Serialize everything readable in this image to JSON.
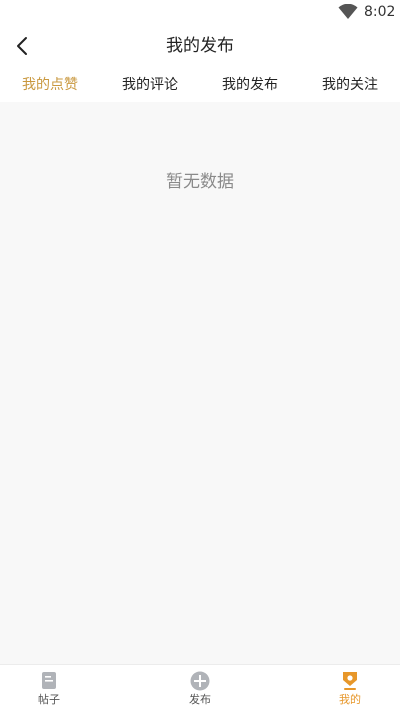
{
  "status_bar": {
    "time": "8:02",
    "wifi_icon": "wifi-icon"
  },
  "header": {
    "back_icon": "back-arrow-icon",
    "title": "我的发布"
  },
  "tabs": [
    {
      "label": "我的点赞",
      "active": true
    },
    {
      "label": "我的评论",
      "active": false
    },
    {
      "label": "我的发布",
      "active": false
    },
    {
      "label": "我的关注",
      "active": false
    }
  ],
  "content": {
    "empty_text": "暂无数据"
  },
  "bottom_nav": {
    "items": [
      {
        "label": "帖子",
        "icon": "document-icon",
        "active": false
      },
      {
        "label": "发布",
        "icon": "plus-circle-icon",
        "active": false
      },
      {
        "label": "我的",
        "icon": "badge-icon",
        "active": true
      }
    ]
  },
  "colors": {
    "active_tab": "#c9983f",
    "active_nav": "#e7972a",
    "content_bg": "#f8f8f8"
  }
}
